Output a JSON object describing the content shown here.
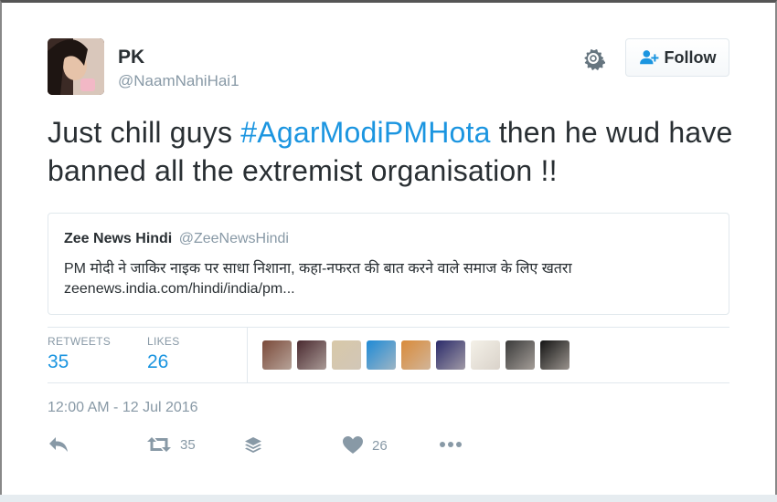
{
  "user": {
    "name": "PK",
    "handle": "@NaamNahiHai1"
  },
  "follow_button": {
    "label": "Follow"
  },
  "tweet": {
    "text_before": "Just chill guys ",
    "hashtag": "#AgarModiPMHota",
    "text_after": " then he wud have banned all the extremist organisation !!"
  },
  "quoted_tweet": {
    "name": "Zee News Hindi",
    "handle": "@ZeeNewsHindi",
    "text": "PM मोदी ने जाकिर नाइक पर साधा निशाना, कहा-नफरत की बात करने वाले समाज के लिए खतरा",
    "link": "zeenews.india.com/hindi/india/pm..."
  },
  "stats": {
    "retweets_label": "RETWEETS",
    "retweets": "35",
    "likes_label": "LIKES",
    "likes": "26"
  },
  "liker_avatars": [
    {
      "name": "liker-avatar-1",
      "color": "#7a4a3a"
    },
    {
      "name": "liker-avatar-2",
      "color": "#4a2a30"
    },
    {
      "name": "liker-avatar-3",
      "color": "#d8c8a8"
    },
    {
      "name": "liker-avatar-4",
      "color": "#1f8ad6"
    },
    {
      "name": "liker-avatar-5",
      "color": "#d98a3a"
    },
    {
      "name": "liker-avatar-6",
      "color": "#2b2b6a"
    },
    {
      "name": "liker-avatar-7",
      "color": "#f4f1e8"
    },
    {
      "name": "liker-avatar-8",
      "color": "#3a3a3a"
    },
    {
      "name": "liker-avatar-9",
      "color": "#141414"
    }
  ],
  "timestamp": "12:00 AM - 12 Jul 2016",
  "actions": {
    "retweet_count": "35",
    "like_count": "26"
  },
  "colors": {
    "accent": "#1b95e0",
    "muted": "#8899a6",
    "text": "#292f33",
    "border": "#e1e8ed"
  }
}
